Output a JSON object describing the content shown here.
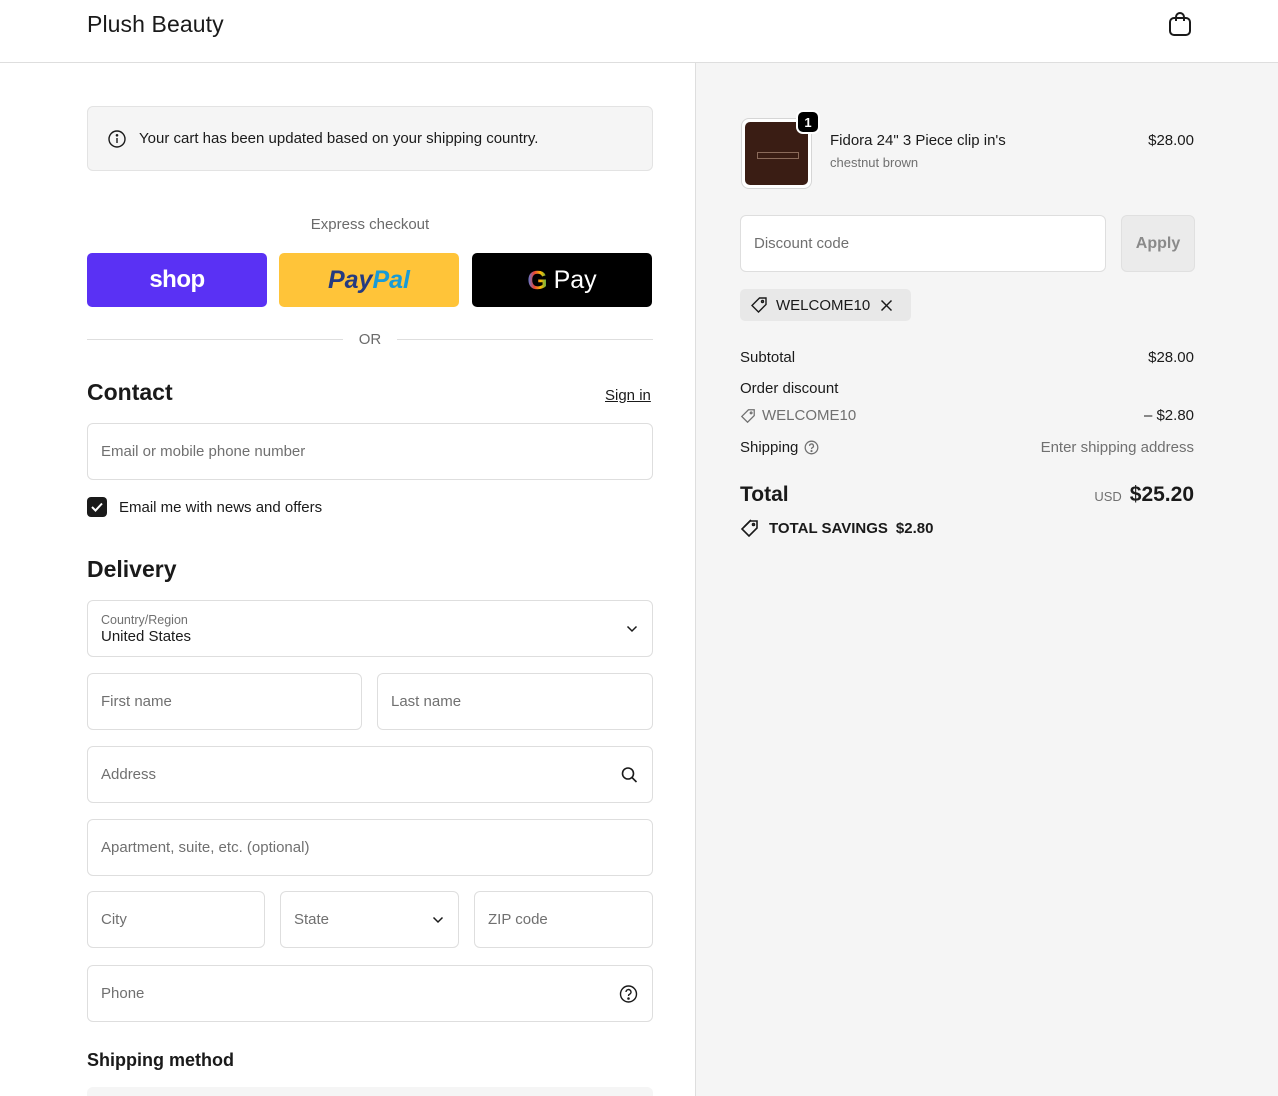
{
  "header": {
    "brand": "Plush Beauty",
    "cart_icon": "shopping-bag-icon"
  },
  "notice": {
    "text": "Your cart has been updated based on your shipping country."
  },
  "express": {
    "label": "Express checkout",
    "shop_label": "shop",
    "paypal_part1": "Pay",
    "paypal_part2": "Pal",
    "gpay_g": "G",
    "gpay_label": "Pay",
    "or_label": "OR"
  },
  "contact": {
    "title": "Contact",
    "signin_label": "Sign in",
    "email_placeholder": "Email or mobile phone number",
    "newsletter_label": "Email me with news and offers",
    "newsletter_checked": true
  },
  "delivery": {
    "title": "Delivery",
    "country_label": "Country/Region",
    "country_value": "United States",
    "first_name_placeholder": "First name",
    "last_name_placeholder": "Last name",
    "address_placeholder": "Address",
    "apartment_placeholder": "Apartment, suite, etc. (optional)",
    "city_placeholder": "City",
    "state_placeholder": "State",
    "zip_placeholder": "ZIP code",
    "phone_placeholder": "Phone"
  },
  "shipping_method": {
    "title": "Shipping method"
  },
  "summary": {
    "product": {
      "quantity": "1",
      "name": "Fidora 24\" 3 Piece clip in's",
      "variant": "chestnut brown",
      "price": "$28.00"
    },
    "discount_placeholder": "Discount code",
    "apply_label": "Apply",
    "applied_code": "WELCOME10",
    "subtotal_label": "Subtotal",
    "subtotal_value": "$28.00",
    "order_discount_label": "Order discount",
    "discount_code": "WELCOME10",
    "discount_value": "– $2.80",
    "shipping_label": "Shipping",
    "shipping_value": "Enter shipping address",
    "total_label": "Total",
    "currency": "USD",
    "total_value": "$25.20",
    "savings_label": "TOTAL SAVINGS",
    "savings_value": "$2.80"
  },
  "colors": {
    "shop": "#5a31f4",
    "paypal": "#ffc439",
    "gpay": "#000000",
    "summary_bg": "#f5f5f5"
  }
}
